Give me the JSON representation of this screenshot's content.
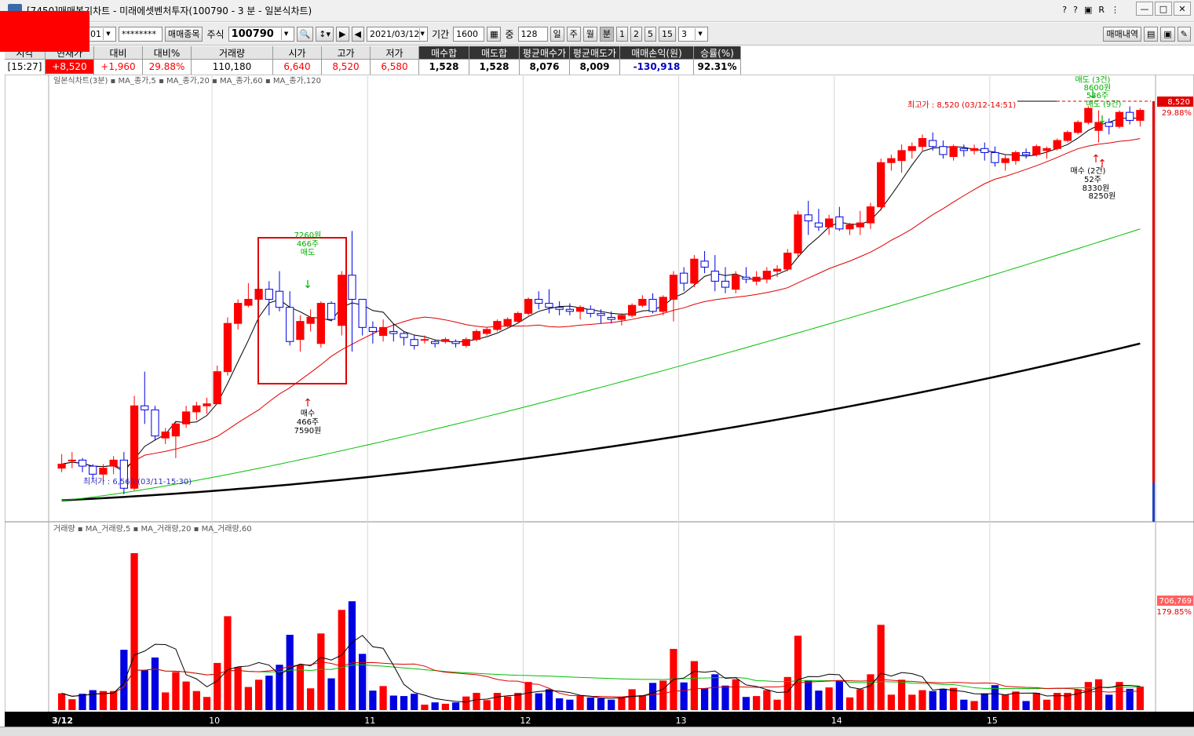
{
  "window": {
    "title": "[7450]매매복기차트 - 미래에셋벤처투자(100790 - 3 분 - 일본식차트)",
    "tools": [
      "?",
      "?",
      "?",
      "R",
      "?"
    ]
  },
  "toolbar": {
    "account_suffix": "01",
    "password": "********",
    "item_button": "매매종목",
    "market": "주식",
    "code": "100790",
    "date": "2021/03/12",
    "period_label": "기간",
    "period_value": "1600",
    "count_label": "중",
    "count_value": "128",
    "units": [
      "일",
      "주",
      "월",
      "분"
    ],
    "active_unit": "분",
    "minute_options": [
      "1",
      "2",
      "5",
      "15"
    ],
    "minute_select": "3",
    "history_button": "매매내역"
  },
  "quote": {
    "headers": [
      "시각",
      "현재가",
      "대비",
      "대비%",
      "거래량",
      "시가",
      "고가",
      "저가",
      "매수합",
      "매도합",
      "평균매수가",
      "평균매도가",
      "매매손익(원)",
      "승률(%)"
    ],
    "values": [
      "[15:27]",
      "+8,520",
      "+1,960",
      "29.88%",
      "110,180",
      "6,640",
      "8,520",
      "6,580",
      "1,528",
      "1,528",
      "8,076",
      "8,009",
      "-130,918",
      "92.31%"
    ]
  },
  "chart_data": [
    {
      "type": "candlestick",
      "title": "일본식차트(3분)",
      "legend": [
        "MA_종가,5",
        "MA_종가,20",
        "MA_종가,60",
        "MA_종가,120"
      ],
      "legend_colors": [
        "#000000",
        "#e00000",
        "#00b000",
        "#000000"
      ],
      "x_labels": [
        "3/12",
        "10",
        "11",
        "12",
        "13",
        "14",
        "15"
      ],
      "current_price": "8,520",
      "current_pct": "29.88%",
      "high_label": "최고가 : 8,520 (03/12-14:51)",
      "low_label": "최저가 : 6,560 (03/11-15:30)",
      "annotations": {
        "sell1": [
          "7260원",
          "466주",
          "매도"
        ],
        "buy1": [
          "매수",
          "466주",
          "7590원"
        ],
        "sell2": [
          "매도 (3건)",
          "8600원",
          "536주"
        ],
        "sell3": "매도 (9건)",
        "buy2": [
          "매수 (2건)",
          "52주",
          "8330원",
          "8250원"
        ]
      },
      "candles": [
        [
          6720,
          6790,
          6700,
          6740
        ],
        [
          6760,
          6800,
          6720,
          6760
        ],
        [
          6760,
          6770,
          6700,
          6730
        ],
        [
          6730,
          6740,
          6660,
          6690
        ],
        [
          6690,
          6740,
          6650,
          6720
        ],
        [
          6730,
          6780,
          6690,
          6760
        ],
        [
          6760,
          6800,
          6590,
          6620
        ],
        [
          6620,
          7080,
          6610,
          7030
        ],
        [
          7030,
          7200,
          6940,
          7010
        ],
        [
          7010,
          7030,
          6860,
          6880
        ],
        [
          6870,
          6920,
          6840,
          6900
        ],
        [
          6880,
          6950,
          6770,
          6940
        ],
        [
          6940,
          7030,
          6920,
          7000
        ],
        [
          7000,
          7050,
          6960,
          7030
        ],
        [
          7030,
          7070,
          6990,
          7040
        ],
        [
          7040,
          7230,
          7150,
          7200
        ],
        [
          7200,
          7470,
          7180,
          7440
        ],
        [
          7440,
          7560,
          7410,
          7540
        ],
        [
          7530,
          7640,
          7520,
          7560
        ],
        [
          7560,
          7640,
          7500,
          7610
        ],
        [
          7610,
          7650,
          7480,
          7560
        ],
        [
          7600,
          7700,
          7500,
          7520
        ],
        [
          7520,
          7600,
          7330,
          7350
        ],
        [
          7360,
          7480,
          7300,
          7450
        ],
        [
          7440,
          7510,
          7400,
          7470
        ],
        [
          7340,
          7550,
          7320,
          7540
        ],
        [
          7540,
          7550,
          7450,
          7460
        ],
        [
          7430,
          7700,
          7380,
          7680
        ],
        [
          7680,
          7900,
          7300,
          7560
        ],
        [
          7560,
          7560,
          7380,
          7420
        ],
        [
          7420,
          7450,
          7340,
          7400
        ],
        [
          7380,
          7460,
          7350,
          7420
        ],
        [
          7400,
          7440,
          7350,
          7390
        ],
        [
          7390,
          7400,
          7330,
          7370
        ],
        [
          7360,
          7380,
          7310,
          7330
        ],
        [
          7360,
          7380,
          7340,
          7360
        ],
        [
          7350,
          7360,
          7320,
          7340
        ],
        [
          7350,
          7370,
          7340,
          7360
        ],
        [
          7350,
          7360,
          7320,
          7340
        ],
        [
          7330,
          7370,
          7320,
          7360
        ],
        [
          7360,
          7410,
          7350,
          7400
        ],
        [
          7390,
          7420,
          7380,
          7410
        ],
        [
          7410,
          7460,
          7400,
          7450
        ],
        [
          7430,
          7470,
          7420,
          7460
        ],
        [
          7450,
          7500,
          7440,
          7490
        ],
        [
          7490,
          7570,
          7480,
          7560
        ],
        [
          7560,
          7600,
          7510,
          7540
        ],
        [
          7540,
          7610,
          7490,
          7520
        ],
        [
          7520,
          7550,
          7480,
          7510
        ],
        [
          7510,
          7540,
          7480,
          7500
        ],
        [
          7500,
          7530,
          7460,
          7520
        ],
        [
          7510,
          7530,
          7470,
          7490
        ],
        [
          7490,
          7510,
          7440,
          7480
        ],
        [
          7470,
          7500,
          7440,
          7460
        ],
        [
          7460,
          7490,
          7430,
          7480
        ],
        [
          7480,
          7540,
          7470,
          7530
        ],
        [
          7530,
          7580,
          7520,
          7560
        ],
        [
          7560,
          7590,
          7490,
          7500
        ],
        [
          7500,
          7580,
          7480,
          7570
        ],
        [
          7560,
          7700,
          7450,
          7680
        ],
        [
          7690,
          7720,
          7600,
          7640
        ],
        [
          7640,
          7780,
          7620,
          7760
        ],
        [
          7750,
          7800,
          7690,
          7720
        ],
        [
          7700,
          7780,
          7600,
          7650
        ],
        [
          7650,
          7720,
          7590,
          7620
        ],
        [
          7610,
          7700,
          7590,
          7680
        ],
        [
          7670,
          7720,
          7640,
          7660
        ],
        [
          7650,
          7700,
          7630,
          7670
        ],
        [
          7660,
          7720,
          7640,
          7700
        ],
        [
          7700,
          7730,
          7670,
          7710
        ],
        [
          7710,
          7810,
          7700,
          7790
        ],
        [
          7790,
          8000,
          7770,
          7980
        ],
        [
          7980,
          8050,
          7880,
          7950
        ],
        [
          7940,
          8010,
          7900,
          7920
        ],
        [
          7920,
          7980,
          7880,
          7960
        ],
        [
          7970,
          8020,
          7900,
          7910
        ],
        [
          7910,
          7940,
          7880,
          7930
        ],
        [
          7920,
          8000,
          7880,
          7940
        ],
        [
          7940,
          8040,
          7910,
          8020
        ],
        [
          8020,
          8260,
          8000,
          8240
        ],
        [
          8240,
          8280,
          8200,
          8260
        ],
        [
          8250,
          8330,
          8190,
          8300
        ],
        [
          8300,
          8340,
          8260,
          8320
        ],
        [
          8320,
          8380,
          8300,
          8360
        ],
        [
          8350,
          8390,
          8300,
          8320
        ],
        [
          8320,
          8350,
          8260,
          8280
        ],
        [
          8270,
          8330,
          8250,
          8320
        ],
        [
          8310,
          8330,
          8270,
          8300
        ],
        [
          8300,
          8330,
          8280,
          8310
        ],
        [
          8310,
          8340,
          8250,
          8290
        ],
        [
          8290,
          8320,
          8220,
          8240
        ],
        [
          8240,
          8280,
          8200,
          8260
        ],
        [
          8250,
          8300,
          8230,
          8290
        ],
        [
          8290,
          8310,
          8260,
          8280
        ],
        [
          8280,
          8330,
          8270,
          8320
        ],
        [
          8300,
          8320,
          8260,
          8310
        ],
        [
          8310,
          8360,
          8300,
          8350
        ],
        [
          8350,
          8400,
          8340,
          8390
        ],
        [
          8390,
          8450,
          8380,
          8440
        ],
        [
          8440,
          8520,
          8430,
          8510
        ],
        [
          8400,
          8500,
          8340,
          8440
        ],
        [
          8440,
          8460,
          8380,
          8420
        ],
        [
          8420,
          8500,
          8410,
          8490
        ],
        [
          8490,
          8520,
          8430,
          8450
        ],
        [
          8450,
          8510,
          8420,
          8500
        ]
      ]
    },
    {
      "type": "bar",
      "title": "거래량",
      "legend": [
        "MA_거래량,5",
        "MA_거래량,20",
        "MA_거래량,60"
      ],
      "legend_colors": [
        "#000000",
        "#e00000",
        "#00b000"
      ],
      "current_volume": "706,769",
      "current_pct": "179.85%"
    }
  ]
}
